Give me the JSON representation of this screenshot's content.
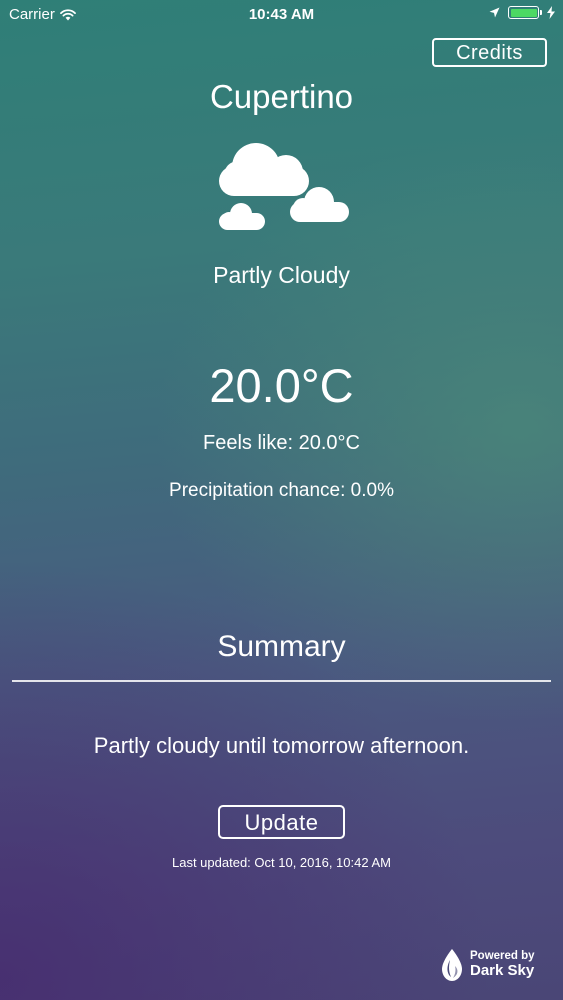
{
  "status_bar": {
    "carrier": "Carrier",
    "time": "10:43 AM",
    "icons": [
      "wifi-icon",
      "location-arrow-icon",
      "battery-icon",
      "charging-icon"
    ]
  },
  "credits_label": "Credits",
  "location": "Cupertino",
  "weather": {
    "icon": "partly-cloudy-icon",
    "condition": "Partly Cloudy",
    "temperature": "20.0°C",
    "feels_like": "Feels like: 20.0°C",
    "precipitation": "Precipitation chance: 0.0%"
  },
  "summary": {
    "title": "Summary",
    "text": "Partly cloudy until tomorrow afternoon."
  },
  "update_label": "Update",
  "last_updated": "Last updated: Oct 10, 2016, 10:42 AM",
  "attribution": {
    "line1": "Powered by",
    "line2": "Dark Sky",
    "icon": "dark-sky-logo-icon"
  },
  "colors": {
    "battery": "#4cd964",
    "text": "#ffffff"
  }
}
